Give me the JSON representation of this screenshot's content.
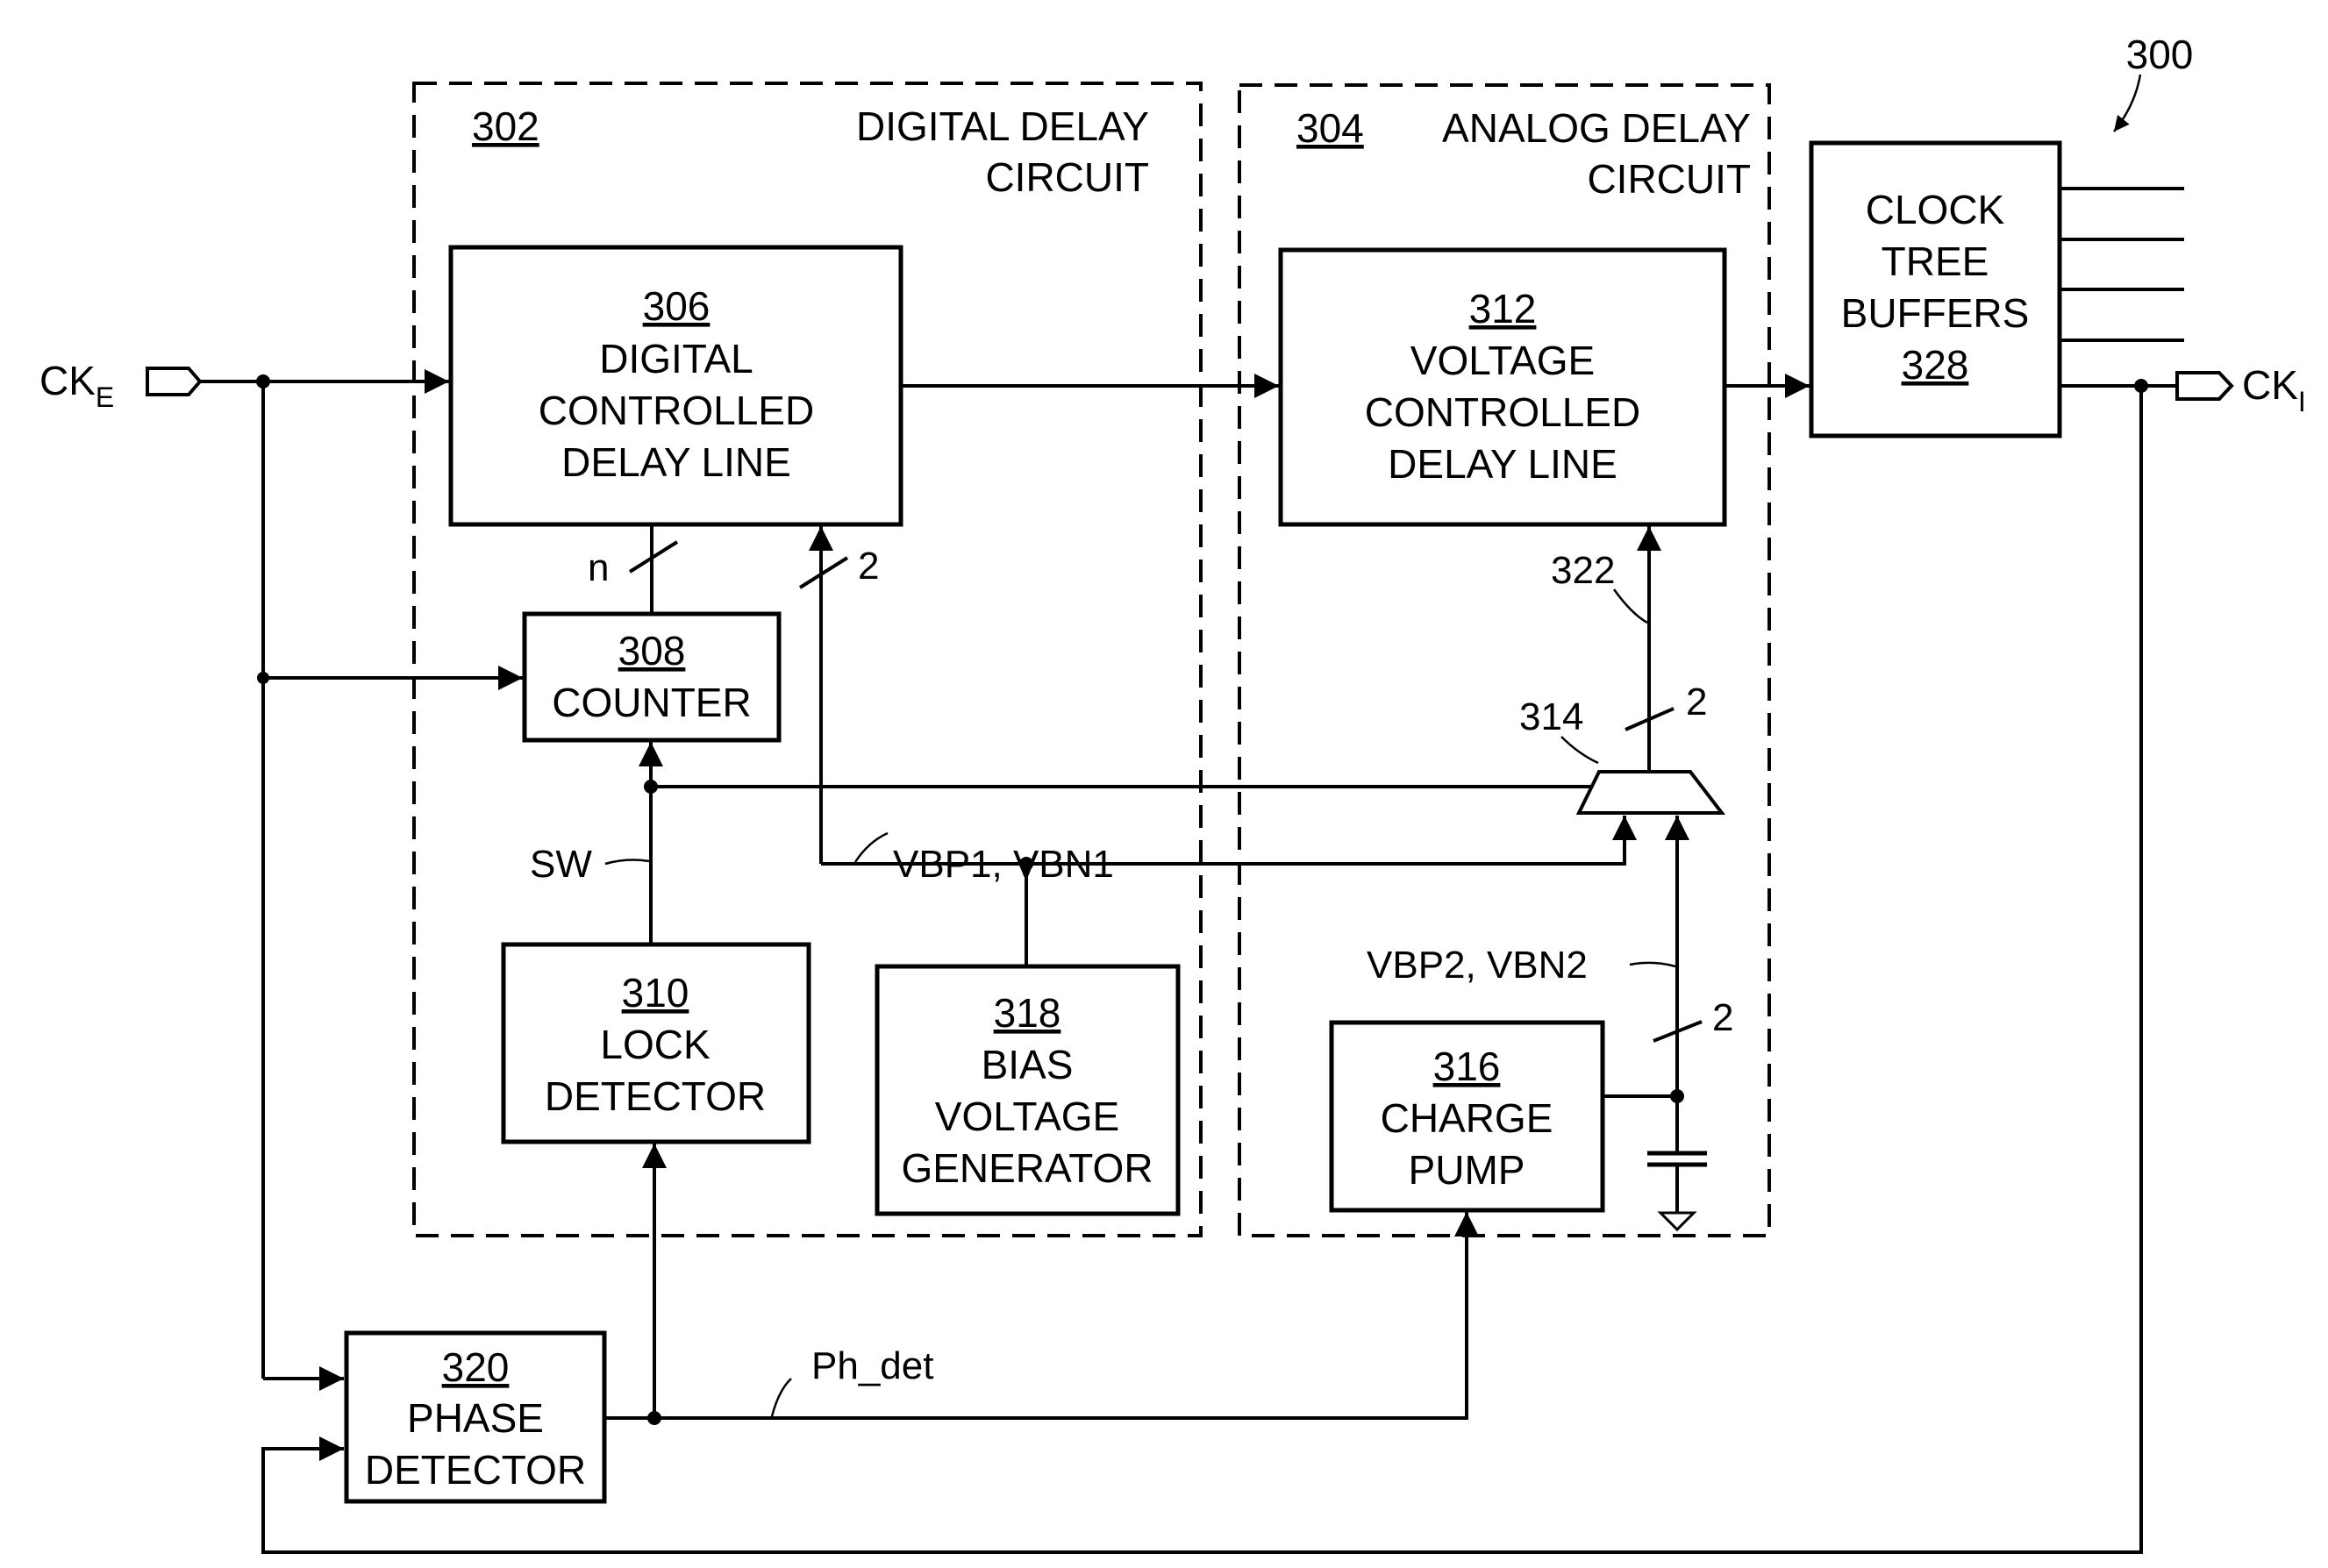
{
  "figure": {
    "ref": "300",
    "blocks": {
      "digital_delay_circuit": {
        "ref": "302",
        "title_line1": "DIGITAL DELAY",
        "title_line2": "CIRCUIT"
      },
      "analog_delay_circuit": {
        "ref": "304",
        "title_line1": "ANALOG DELAY",
        "title_line2": "CIRCUIT"
      },
      "dcdl": {
        "ref": "306",
        "lines": [
          "DIGITAL",
          "CONTROLLED",
          "DELAY LINE"
        ]
      },
      "counter": {
        "ref": "308",
        "lines": [
          "COUNTER"
        ]
      },
      "lock_detector": {
        "ref": "310",
        "lines": [
          "LOCK",
          "DETECTOR"
        ]
      },
      "vcdl": {
        "ref": "312",
        "lines": [
          "VOLTAGE",
          "CONTROLLED",
          "DELAY LINE"
        ]
      },
      "mux": {
        "ref": "314"
      },
      "charge_pump": {
        "ref": "316",
        "lines": [
          "CHARGE",
          "PUMP"
        ]
      },
      "bias_gen": {
        "ref": "318",
        "lines": [
          "BIAS",
          "VOLTAGE",
          "GENERATOR"
        ]
      },
      "phase_detector": {
        "ref": "320",
        "lines": [
          "PHASE",
          "DETECTOR"
        ]
      },
      "clock_tree": {
        "lines": [
          "CLOCK",
          "TREE",
          "BUFFERS"
        ],
        "ref": "328"
      }
    },
    "signals": {
      "ck_in": "CK",
      "ck_in_sub": "E",
      "ck_out": "CK",
      "ck_out_sub": "I",
      "bus_n": "n",
      "bus_2a": "2",
      "bus_2b": "2",
      "bus_2c": "2",
      "sw": "SW",
      "vbp1": "VBP1, VBN1",
      "vbp2": "VBP2, VBN2",
      "ph_det": "Ph_det",
      "line_322": "322",
      "ref_314": "314"
    }
  }
}
